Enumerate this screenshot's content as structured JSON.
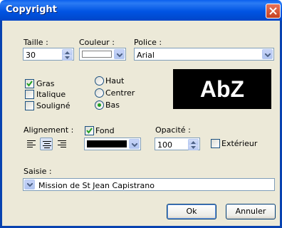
{
  "window": {
    "title": "Copyright"
  },
  "taille": {
    "label": "Taille :",
    "value": "30"
  },
  "couleur": {
    "label": "Couleur :",
    "swatch": "#ffffff"
  },
  "police": {
    "label": "Police :",
    "value": "Arial"
  },
  "style": {
    "gras": {
      "label": "Gras",
      "checked": true
    },
    "italique": {
      "label": "Italique",
      "checked": false
    },
    "souligne": {
      "label": "Souligné",
      "checked": false
    }
  },
  "position": {
    "haut": {
      "label": "Haut",
      "selected": false
    },
    "centrer": {
      "label": "Centrer",
      "selected": false
    },
    "bas": {
      "label": "Bas",
      "selected": true
    }
  },
  "preview": {
    "text": "AbZ"
  },
  "alignement": {
    "label": "Alignement :",
    "selected": "center"
  },
  "fond": {
    "label": "Fond",
    "checked": true,
    "swatch": "#000000"
  },
  "opacite": {
    "label": "Opacité :",
    "value": "100"
  },
  "exterieur": {
    "label": "Extérieur",
    "checked": false
  },
  "saisie": {
    "label": "Saisie :",
    "value": "Mission de St Jean Capistrano"
  },
  "buttons": {
    "ok": "Ok",
    "annuler": "Annuler"
  }
}
